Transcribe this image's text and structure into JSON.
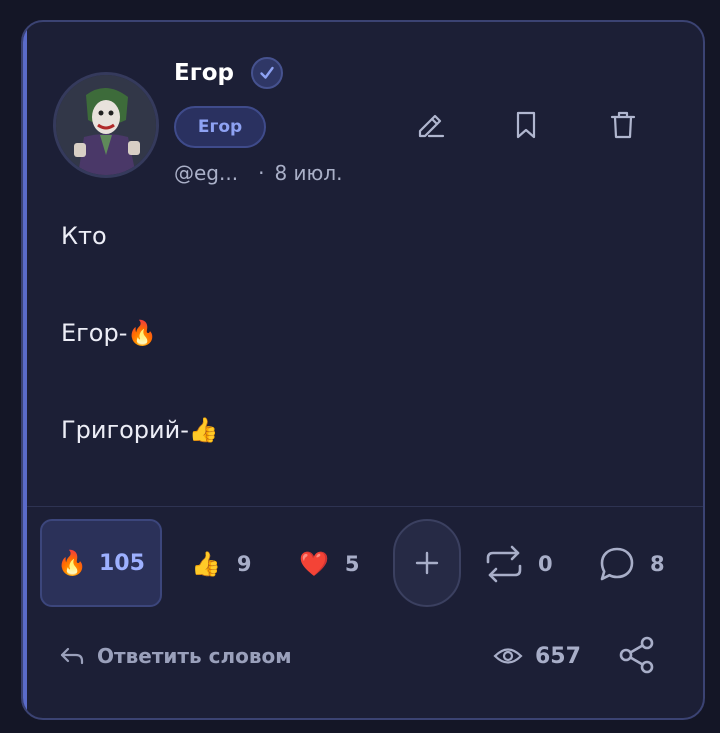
{
  "post": {
    "author": {
      "name": "Егор",
      "verified_icon": "verified-check-icon",
      "tag": "Егор",
      "handle": "@eg...",
      "separator": "·",
      "date": "8 июл."
    },
    "actions": {
      "edit_icon": "pencil-icon",
      "bookmark_icon": "bookmark-icon",
      "delete_icon": "trash-icon"
    },
    "content": {
      "line1": "Кто",
      "line2": "Егор-🔥",
      "line3": "Григорий-👍"
    },
    "reactions": [
      {
        "emoji": "🔥",
        "count": "105",
        "active": true
      },
      {
        "emoji": "👍",
        "count": "9",
        "active": false
      },
      {
        "emoji": "❤️",
        "count": "5",
        "active": false
      }
    ],
    "add_reaction_icon": "plus-icon",
    "reposts": {
      "icon": "repost-icon",
      "count": "0"
    },
    "comments": {
      "icon": "comment-icon",
      "count": "8"
    },
    "footer": {
      "reply_icon": "reply-arrow-icon",
      "reply_label": "Ответить словом",
      "views_icon": "eye-icon",
      "views_count": "657",
      "share_icon": "share-icon"
    }
  },
  "colors": {
    "background": "#141626",
    "card": "#1c1f36",
    "accent": "#8ea2f3",
    "active_reaction_bg": "#2b3159"
  }
}
